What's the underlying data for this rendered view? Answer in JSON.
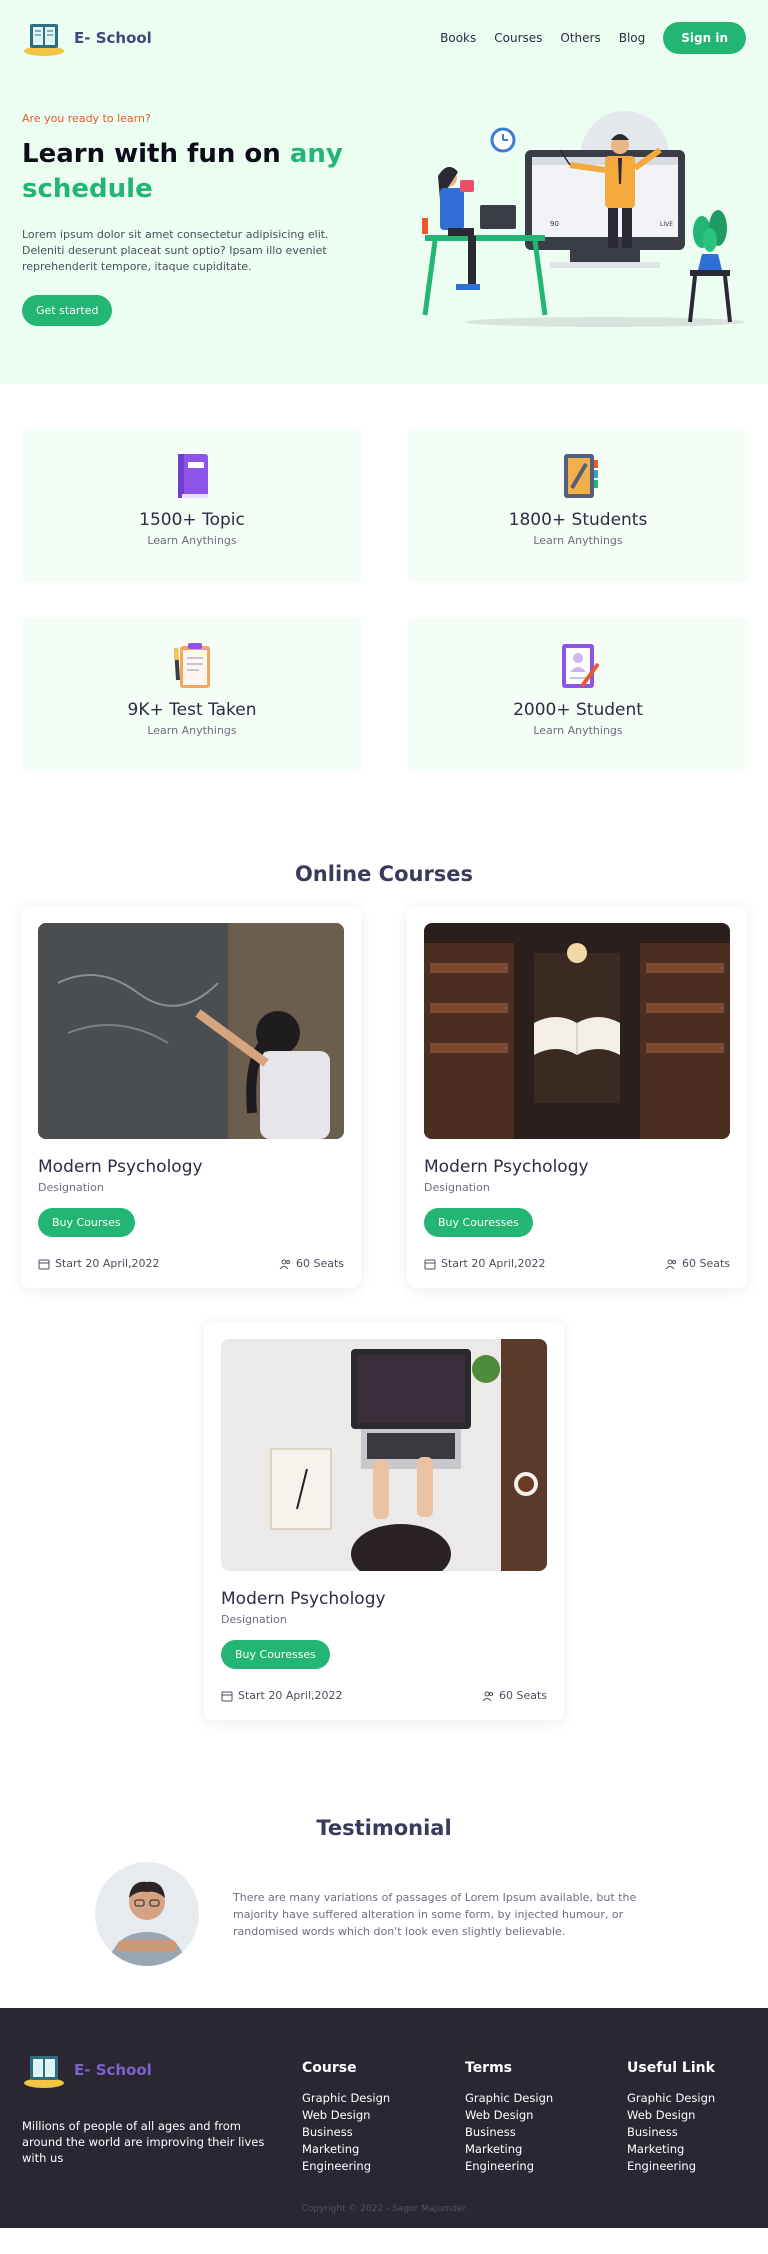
{
  "brand": {
    "name": "E- School"
  },
  "nav": {
    "links": [
      "Books",
      "Courses",
      "Others",
      "Blog"
    ],
    "signin": "Sign in"
  },
  "hero": {
    "eyebrow": "Are you ready to learn?",
    "headline_line1": "Learn with fun on ",
    "headline_accent1": "any",
    "headline_accent2": "schedule",
    "body": "Lorem ipsum dolor sit amet consectetur adipisicing elit. Deleniti deserunt placeat sunt optio? Ipsam illo eveniet reprehenderit tempore, itaque cupiditate.",
    "cta": "Get started",
    "screen_badge": "LIVE",
    "screen_count": "90"
  },
  "stats": [
    {
      "value": "1500+ Topic",
      "sub": "Learn Anythings",
      "icon": "book-icon"
    },
    {
      "value": "1800+ Students",
      "sub": "Learn Anythings",
      "icon": "notebook-icon"
    },
    {
      "value": "9K+ Test Taken",
      "sub": "Learn Anythings",
      "icon": "clipboard-pen-icon"
    },
    {
      "value": "2000+ Student",
      "sub": "Learn Anythings",
      "icon": "certificate-icon"
    }
  ],
  "courses": {
    "title": "Online Courses",
    "items": [
      {
        "name": "Modern Psychology",
        "sub": "Designation",
        "button": "Buy Courses",
        "date": "Start 20 April,2022",
        "seats": "60 Seats"
      },
      {
        "name": "Modern Psychology",
        "sub": "Designation",
        "button": "Buy Couresses",
        "date": "Start 20 April,2022",
        "seats": "60 Seats"
      },
      {
        "name": "Modern Psychology",
        "sub": "Designation",
        "button": "Buy Couresses",
        "date": "Start 20 April,2022",
        "seats": "60 Seats"
      }
    ]
  },
  "testimonial": {
    "title": "Testimonial",
    "quote": "There are many variations of passages of Lorem Ipsum available, but the majority have suffered alteration in some form, by injected humour, or randomised words which don't look even slightly believable."
  },
  "footer": {
    "about": "Millions of people of all ages and from around the world are improving their lives with us",
    "columns": [
      {
        "title": "Course",
        "links": [
          "Graphic Design",
          "Web Design",
          "Business",
          "Marketing",
          "Engineering"
        ]
      },
      {
        "title": "Terms",
        "links": [
          "Graphic Design",
          "Web Design",
          "Business",
          "Marketing",
          "Engineering"
        ]
      },
      {
        "title": "Useful Link",
        "links": [
          "Graphic Design",
          "Web Design",
          "Business",
          "Marketing",
          "Engineering"
        ]
      }
    ],
    "copyright": "Copyright © 2022 - Sagor Majumder"
  },
  "colors": {
    "accent": "#22b573",
    "eyebrow": "#e85a2c",
    "hero_bg": "#ecfdf1",
    "footer_bg": "#2a2632",
    "brand_text": "#3c4a7a"
  }
}
